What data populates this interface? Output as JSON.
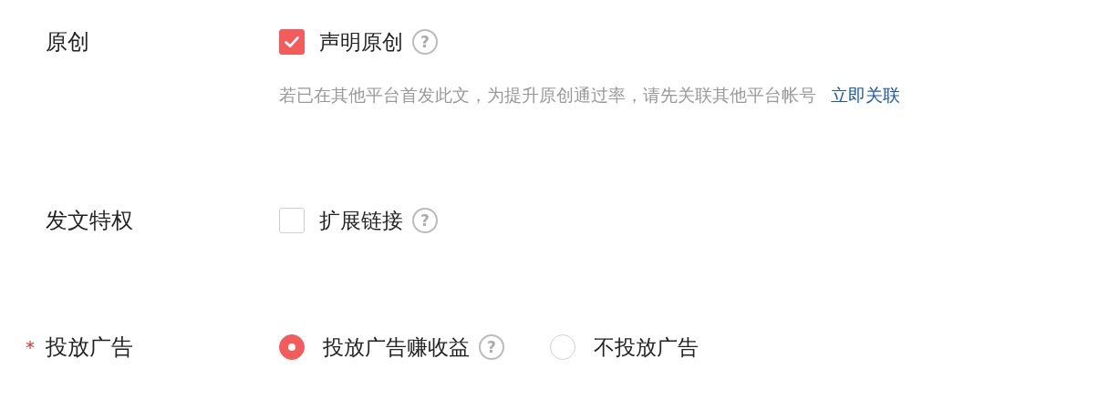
{
  "rows": [
    {
      "label": "原创",
      "required": false,
      "kind": "checkbox",
      "options": [
        {
          "label": "声明原创",
          "checked": true,
          "help": "?"
        }
      ],
      "hint": {
        "text": "若已在其他平台首发此文，为提升原创通过率，请先关联其他平台帐号",
        "link": "立即关联"
      }
    },
    {
      "label": "发文特权",
      "required": false,
      "kind": "checkbox",
      "options": [
        {
          "label": "扩展链接",
          "checked": false,
          "help": "?"
        }
      ]
    },
    {
      "label": "投放广告",
      "required": true,
      "required_mark": "*",
      "kind": "radio",
      "options": [
        {
          "label": "投放广告赚收益",
          "selected": true,
          "help": "?"
        },
        {
          "label": "不投放广告",
          "selected": false
        }
      ]
    }
  ]
}
